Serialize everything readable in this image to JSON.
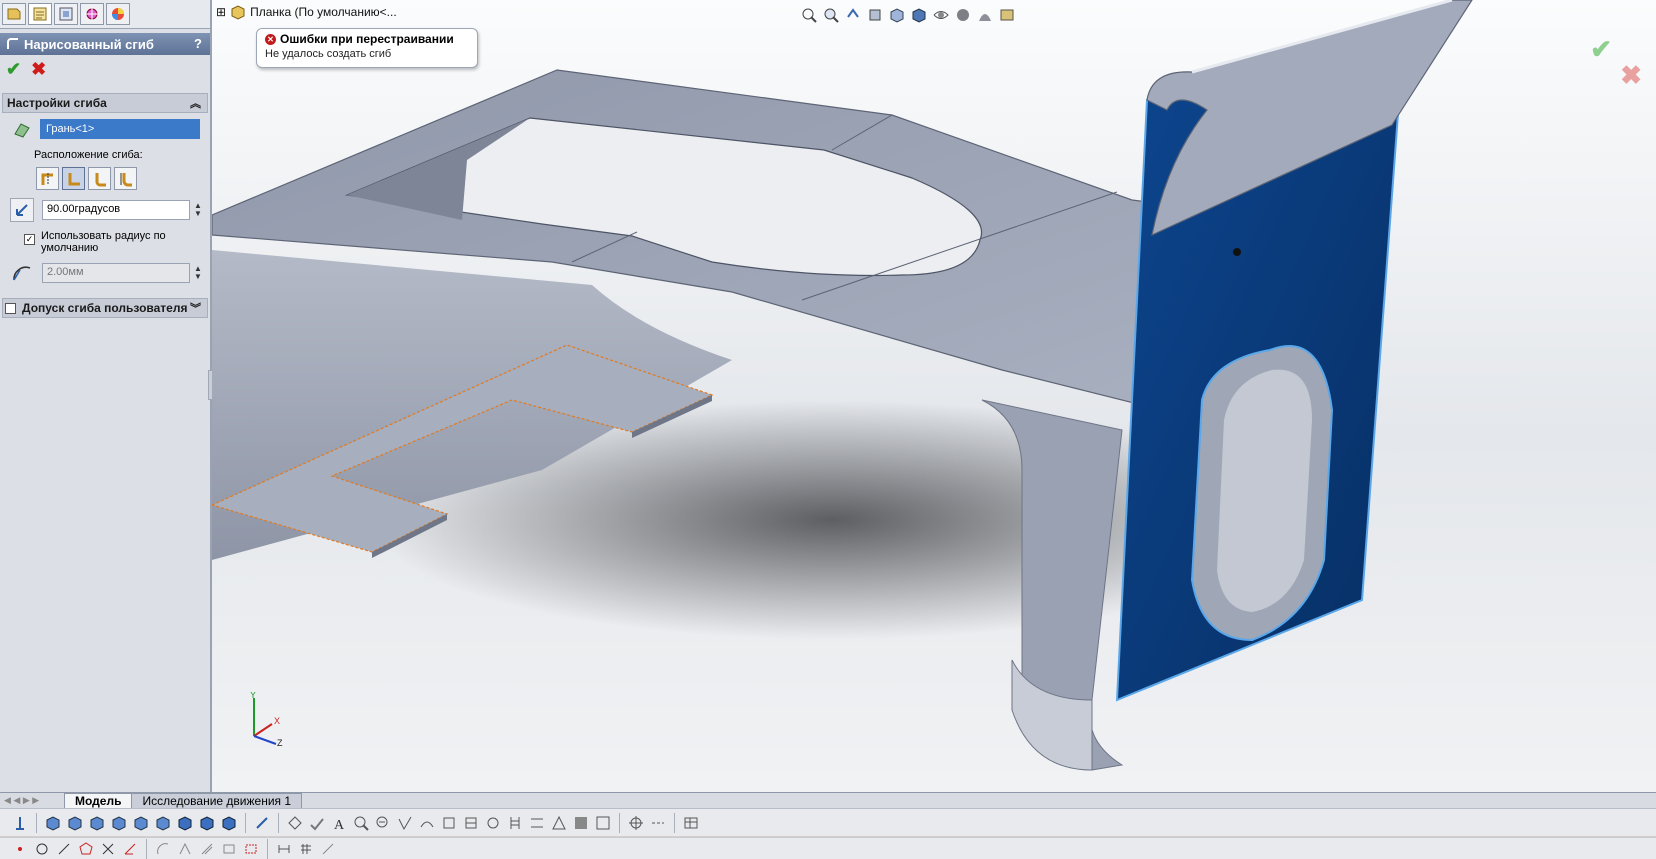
{
  "viewport": {
    "part_label": "Планка  (По умолчанию<...",
    "error_title": "Ошибки при перестраивании",
    "error_message": "Не удалось создать сгиб"
  },
  "property_manager": {
    "title": "Нарисованный сгиб",
    "help": "?",
    "tabs": [
      "feature-manager-icon",
      "property-manager-icon",
      "configuration-manager-icon",
      "dimxpert-icon",
      "display-manager-icon"
    ],
    "bend_settings": {
      "header": "Настройки сгиба",
      "face_selection": "Грань<1>",
      "position_label": "Расположение сгиба:",
      "angle_value": "90.00градусов",
      "use_default_radius_label": "Использовать радиус по умолчанию",
      "use_default_radius_checked": true,
      "radius_value": "2.00мм"
    },
    "custom_allowance": {
      "header": "Допуск сгиба пользователя",
      "checked": false
    }
  },
  "bottom_tabs": [
    "Модель",
    "Исследование движения 1"
  ],
  "colors": {
    "accent_blue": "#0a3a78",
    "edge_highlight": "#e07a22",
    "title_bar": "#6b7fa3"
  }
}
